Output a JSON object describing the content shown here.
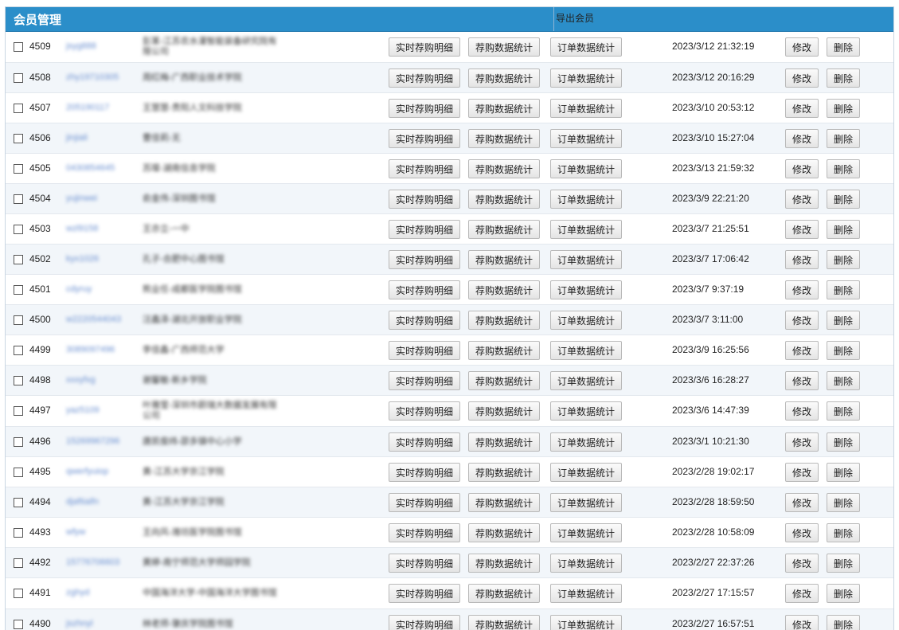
{
  "header": {
    "title": "会员管理",
    "export_label": "导出会员"
  },
  "actions": {
    "detail_label": "实时荐购明细",
    "recommend_stats_label": "荐购数据统计",
    "order_stats_label": "订单数据统计",
    "edit_label": "修改",
    "delete_label": "删除"
  },
  "rows": [
    {
      "id": "4509",
      "username": "jsyg888",
      "org": "彭某-江苏农水灌智能装备研究院有限公司",
      "time": "2023/3/12 21:32:19"
    },
    {
      "id": "4508",
      "username": "zhy19710305",
      "org": "周红梅-广西职业技术学院",
      "time": "2023/3/12 20:16:29"
    },
    {
      "id": "4507",
      "username": "205190117",
      "org": "王慧慧-贵阳人文科技学院",
      "time": "2023/3/10 20:53:12"
    },
    {
      "id": "4506",
      "username": "jinjiali",
      "org": "曹佳莉-无",
      "time": "2023/3/10 15:27:04"
    },
    {
      "id": "4505",
      "username": "0430854645",
      "org": "苏璨-湖南信息学院",
      "time": "2023/3/13 21:59:32"
    },
    {
      "id": "4504",
      "username": "yujinwei",
      "org": "俞金伟-深圳图书馆",
      "time": "2023/3/9 22:21:20"
    },
    {
      "id": "4503",
      "username": "wzl9158",
      "org": "王亦立-一中",
      "time": "2023/3/7 21:25:51"
    },
    {
      "id": "4502",
      "username": "kyx1026",
      "org": "孔子-合肥中心图书馆",
      "time": "2023/3/7 17:06:42"
    },
    {
      "id": "4501",
      "username": "cdyruy",
      "org": "熊业任-成都医学院图书馆",
      "time": "2023/3/7 9:37:19"
    },
    {
      "id": "4500",
      "username": "w2220544043",
      "org": "汪鑫泽-湖北开放职业学院",
      "time": "2023/3/7 3:11:00"
    },
    {
      "id": "4499",
      "username": "3089097496",
      "org": "李佳鑫-广西师范大学",
      "time": "2023/3/9 16:25:56"
    },
    {
      "id": "4498",
      "username": "xxxyfxg",
      "org": "谢馨敏-新乡学院",
      "time": "2023/3/6 16:28:27"
    },
    {
      "id": "4497",
      "username": "yaz5109",
      "org": "叶雅莹-深圳市蔚瑞大数据发展有限公司",
      "time": "2023/3/6 14:47:39"
    },
    {
      "id": "4496",
      "username": "15269967296",
      "org": "唐凯俊纬-邵多镇中心小学",
      "time": "2023/3/1 10:21:30"
    },
    {
      "id": "4495",
      "username": "qwerfyuiop",
      "org": "黄-江苏大学京江学院",
      "time": "2023/2/28 19:02:17"
    },
    {
      "id": "4494",
      "username": "djaftiaifn",
      "org": "黄-江苏大学京江学院",
      "time": "2023/2/28 18:59:50"
    },
    {
      "id": "4493",
      "username": "wfyw",
      "org": "王向风-潍坊医学院图书馆",
      "time": "2023/2/28 10:58:09"
    },
    {
      "id": "4492",
      "username": "15776706603",
      "org": "黄婷-南宁师范大学师园学院",
      "time": "2023/2/27 22:37:26"
    },
    {
      "id": "4491",
      "username": "zghyd",
      "org": "中国海洋大学-中国海洋大学图书馆",
      "time": "2023/2/27 17:15:57"
    },
    {
      "id": "4490",
      "username": "jszhnyl",
      "org": "林老师-肇庆学院图书馆",
      "time": "2023/2/27 16:57:51"
    }
  ]
}
